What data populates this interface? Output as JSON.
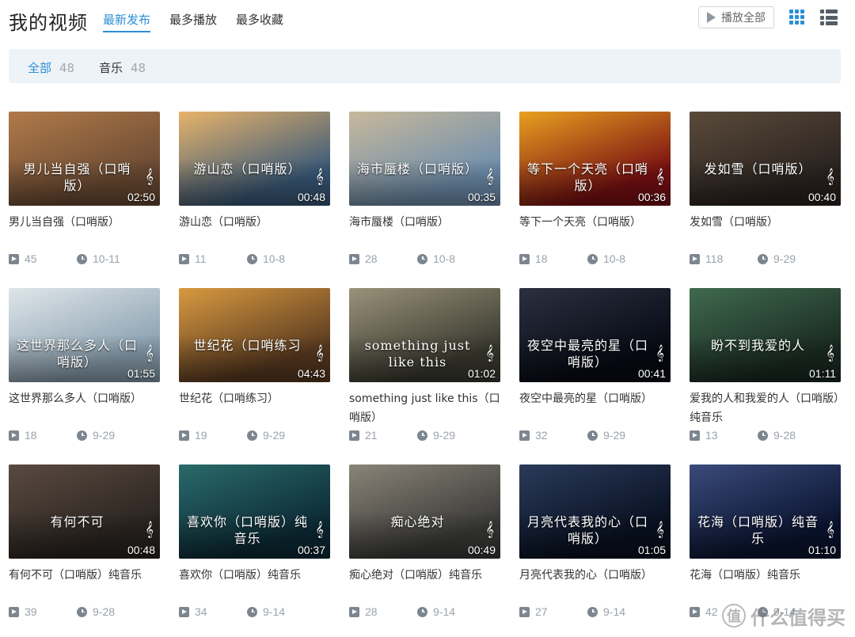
{
  "header": {
    "title": "我的视频",
    "tabs": [
      {
        "label": "最新发布",
        "active": true
      },
      {
        "label": "最多播放",
        "active": false
      },
      {
        "label": "最多收藏",
        "active": false
      }
    ],
    "play_all_label": "播放全部",
    "accent_color": "#2b8fd6"
  },
  "filters": [
    {
      "label": "全部",
      "count": "48",
      "active": true
    },
    {
      "label": "音乐",
      "count": "48",
      "active": false
    }
  ],
  "videos": [
    {
      "title": "男儿当自强（口哨版）",
      "overlay": "男儿当自强（口哨版）",
      "duration": "02:50",
      "plays": "45",
      "date": "10-11"
    },
    {
      "title": "游山恋（口哨版）",
      "overlay": "游山恋（口哨版）",
      "duration": "00:48",
      "plays": "11",
      "date": "10-8"
    },
    {
      "title": "海市蜃楼（口哨版）",
      "overlay": "海市蜃楼（口哨版）",
      "duration": "00:35",
      "plays": "28",
      "date": "10-8"
    },
    {
      "title": "等下一个天亮（口哨版）",
      "overlay": "等下一个天亮（口哨版）",
      "duration": "00:36",
      "plays": "18",
      "date": "10-8"
    },
    {
      "title": "发如雪（口哨版）",
      "overlay": "发如雪（口哨版）",
      "duration": "00:40",
      "plays": "118",
      "date": "9-29"
    },
    {
      "title": "这世界那么多人（口哨版）",
      "overlay": "这世界那么多人（口哨版）",
      "duration": "01:55",
      "plays": "18",
      "date": "9-29"
    },
    {
      "title": "世纪花（口哨练习）",
      "overlay": "世纪花（口哨练习",
      "duration": "04:43",
      "plays": "19",
      "date": "9-29"
    },
    {
      "title": "something just like this（口哨版）",
      "overlay": "something just like this",
      "duration": "01:02",
      "plays": "21",
      "date": "9-29"
    },
    {
      "title": "夜空中最亮的星（口哨版）",
      "overlay": "夜空中最亮的星（口哨版）",
      "duration": "00:41",
      "plays": "32",
      "date": "9-29"
    },
    {
      "title": "爱我的人和我爱的人（口哨版）纯音乐",
      "overlay": "盼不到我爱的人",
      "duration": "01:11",
      "plays": "13",
      "date": "9-28"
    },
    {
      "title": "有何不可（口哨版）纯音乐",
      "overlay": "有何不可",
      "duration": "00:48",
      "plays": "39",
      "date": "9-28"
    },
    {
      "title": "喜欢你（口哨版）纯音乐",
      "overlay": "喜欢你（口哨版）纯音乐",
      "duration": "00:37",
      "plays": "34",
      "date": "9-14"
    },
    {
      "title": "痴心绝对（口哨版）纯音乐",
      "overlay": "痴心绝对",
      "duration": "00:49",
      "plays": "28",
      "date": "9-14"
    },
    {
      "title": "月亮代表我的心（口哨版）",
      "overlay": "月亮代表我的心（口哨版）",
      "duration": "01:05",
      "plays": "27",
      "date": "9-14"
    },
    {
      "title": "花海（口哨版）纯音乐",
      "overlay": "花海（口哨版）纯音乐",
      "duration": "01:10",
      "plays": "42",
      "date": "9-14"
    }
  ],
  "thumb_colors": [
    [
      "#6b4a33",
      "#b07a4a"
    ],
    [
      "#3a5a7a",
      "#e8b36a"
    ],
    [
      "#6f8fae",
      "#c8b89a"
    ],
    [
      "#7a0f12",
      "#e8a020"
    ],
    [
      "#2a2320",
      "#5a4a3a"
    ],
    [
      "#8aa0b0",
      "#dfe6ea"
    ],
    [
      "#5a3a20",
      "#d89a40"
    ],
    [
      "#3a3a30",
      "#9a927a"
    ],
    [
      "#070a14",
      "#2a3040"
    ],
    [
      "#1a2a22",
      "#3f6a4e"
    ],
    [
      "#2a2420",
      "#5a4a40"
    ],
    [
      "#0c2a36",
      "#2a6a6a"
    ],
    [
      "#3a3a38",
      "#8a8478"
    ],
    [
      "#081020",
      "#2a3a5a"
    ],
    [
      "#0a1430",
      "#3a4a7a"
    ]
  ],
  "watermark": {
    "badge": "值",
    "text": "什么值得买"
  }
}
